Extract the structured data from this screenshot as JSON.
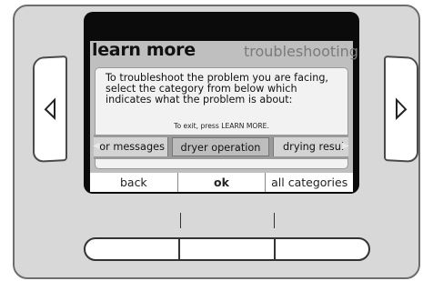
{
  "screen": {
    "header_title": "learn more",
    "header_subtitle": "troubleshooting",
    "dialog": {
      "message": "To troubleshoot the problem you are facing, select the category from below which indicates what the problem is about:",
      "exit_hint": "To exit, press LEARN MORE."
    },
    "categories": [
      "or messages",
      "dryer operation",
      "drying resul"
    ],
    "selected_category": "dryer operation",
    "softkeys": [
      "back",
      "ok",
      "all categories"
    ]
  },
  "controls": {
    "left_icon": "triangle-left-icon",
    "right_icon": "triangle-right-icon"
  },
  "colors": {
    "panel": "#d8d8d8",
    "screen_bezel": "#0b0b0b",
    "display_bg": "#bfbfbf",
    "selected_item": "#bdbdbd"
  }
}
